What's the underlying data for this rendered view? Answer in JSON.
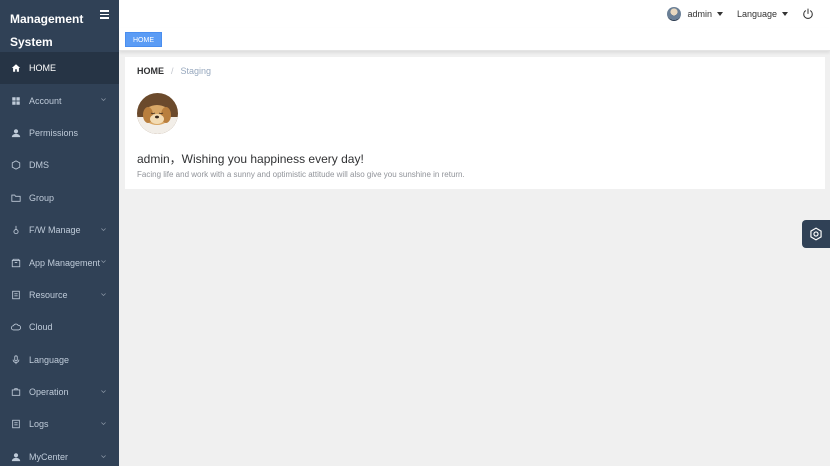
{
  "brand": {
    "title": "Management System"
  },
  "sidebar": {
    "items": [
      {
        "label": "HOME",
        "icon": "home-icon",
        "active": true,
        "expandable": false
      },
      {
        "label": "Account",
        "icon": "grid-icon",
        "expandable": true
      },
      {
        "label": "Permissions",
        "icon": "user-icon",
        "expandable": false
      },
      {
        "label": "DMS",
        "icon": "chip-icon",
        "expandable": false
      },
      {
        "label": "Group",
        "icon": "folder-icon",
        "expandable": false
      },
      {
        "label": "F/W Manage",
        "icon": "tool-icon",
        "expandable": true
      },
      {
        "label": "App Management",
        "icon": "box-icon",
        "expandable": true
      },
      {
        "label": "Resource",
        "icon": "document-icon",
        "expandable": true
      },
      {
        "label": "Cloud",
        "icon": "cloud-icon",
        "expandable": false
      },
      {
        "label": "Language",
        "icon": "microphone-icon",
        "expandable": false
      },
      {
        "label": "Operation",
        "icon": "briefcase-icon",
        "expandable": true
      },
      {
        "label": "Logs",
        "icon": "document-icon",
        "expandable": true
      },
      {
        "label": "MyCenter",
        "icon": "user-icon",
        "expandable": true
      }
    ]
  },
  "topbar": {
    "user": "admin",
    "language": "Language"
  },
  "tags": {
    "active": "HOME"
  },
  "breadcrumb": {
    "home": "HOME",
    "current": "Staging"
  },
  "main": {
    "welcome": "admin，Wishing you happiness every day!",
    "motto": "Facing life and work with a sunny and optimistic attitude will also give you sunshine in return."
  },
  "colors": {
    "sidebar_bg": "#304156",
    "accent": "#5b9cf5"
  }
}
